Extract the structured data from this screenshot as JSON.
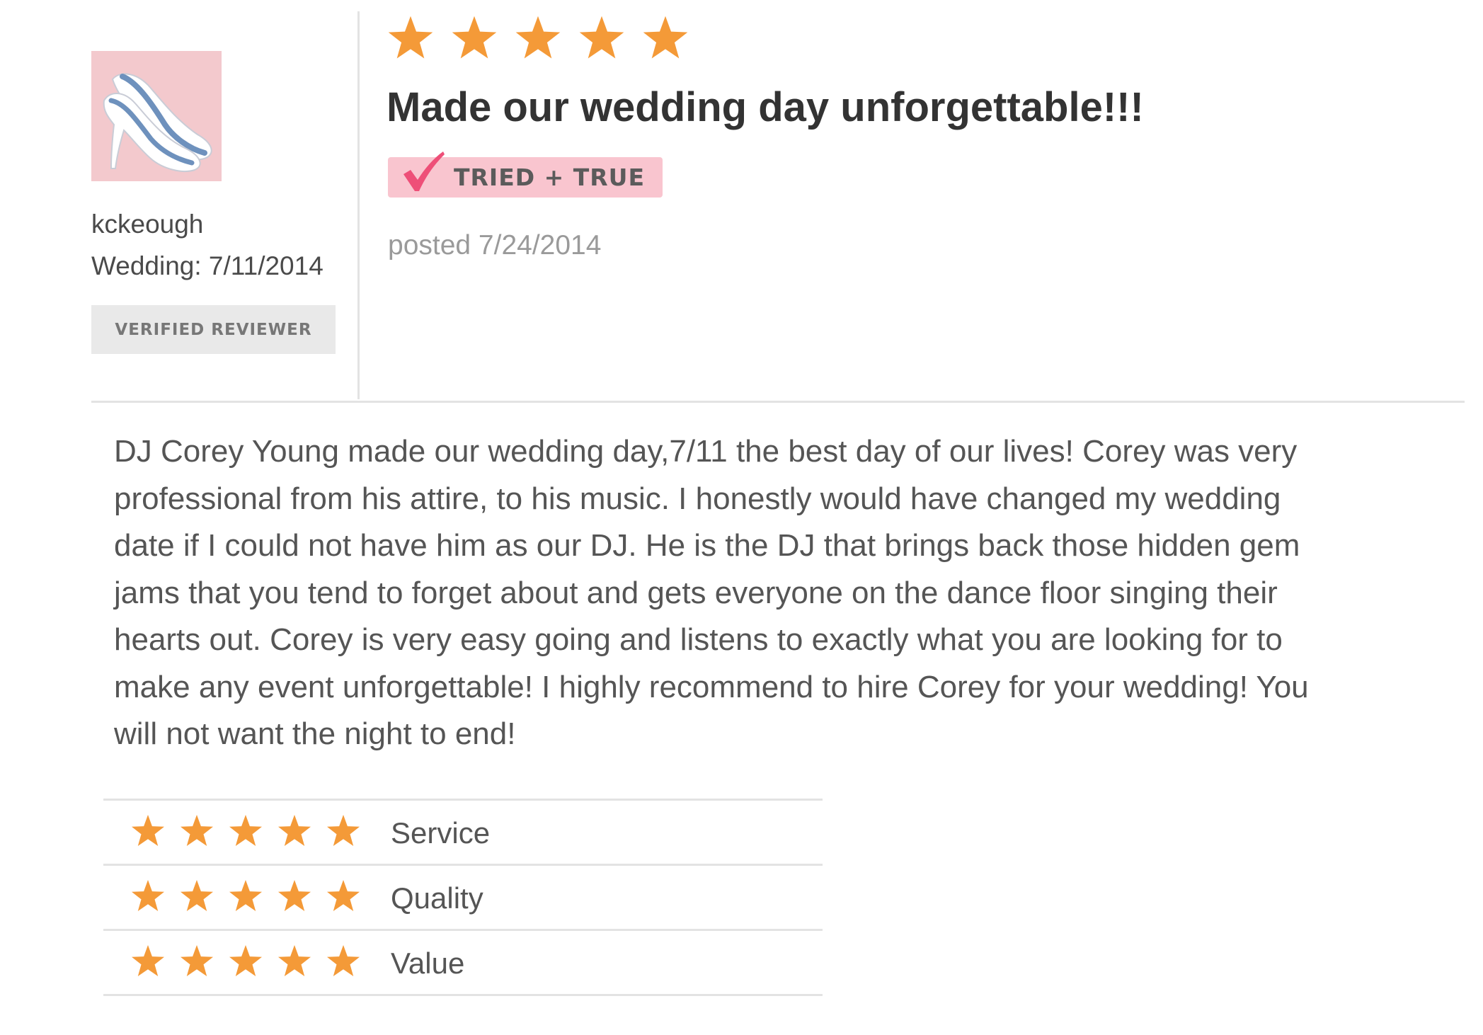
{
  "reviewer": {
    "name": "kckeough",
    "wedding_date": "Wedding: 7/11/2014",
    "verified_label": "VERIFIED REVIEWER",
    "avatar_icon": "bridal-shoes-icon"
  },
  "review": {
    "overall_rating": 5,
    "overall_max": 5,
    "title": "Made our wedding day unforgettable!!!",
    "badge_label": "TRIED + TRUE",
    "badge_icon": "checkmark-icon",
    "posted": "posted 7/24/2014",
    "body_lines": [
      "DJ Corey Young made our wedding day,7/11 the best day of our lives! Corey was very",
      "professional from his attire, to his music. I honestly would have changed my wedding",
      "date if I could not have him as our DJ. He is the DJ that brings back those hidden gem",
      "jams that you tend to forget about and gets everyone on the dance floor singing their",
      "hearts out. Corey is very easy going and listens to exactly what you are looking for to",
      "make any event unforgettable! I highly recommend to hire Corey for your wedding! You",
      "will not want the night to end!"
    ]
  },
  "subratings": [
    {
      "label": "Service",
      "rating": 5,
      "max": 5
    },
    {
      "label": "Quality",
      "rating": 5,
      "max": 5
    },
    {
      "label": "Value",
      "rating": 5,
      "max": 5
    }
  ],
  "colors": {
    "star": "#f49a38",
    "badge_pink": "#f9c5cf",
    "check_pink": "#ee4f78",
    "divider": "#e3e3e3"
  }
}
